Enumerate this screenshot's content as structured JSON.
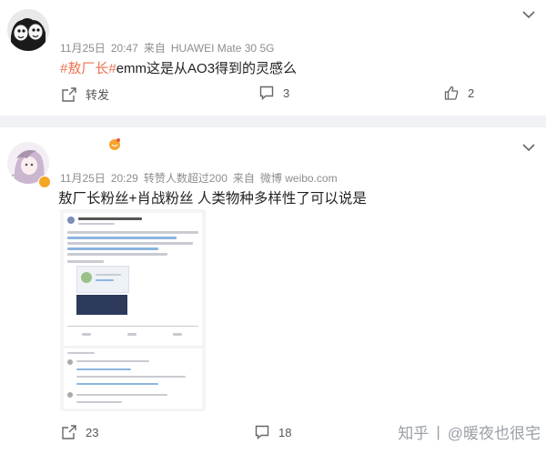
{
  "post1": {
    "date": "11月25日",
    "time": "20:47",
    "source_prefix": "来自",
    "source": "HUAWEI Mate 30 5G",
    "tag_text": "#敖厂长#",
    "text": "emm这是从AO3得到的灵感么",
    "repost_label": "转发",
    "comment_count": "3",
    "like_count": "2"
  },
  "post2": {
    "date": "11月25日",
    "time": "20:29",
    "extra": "转赞人数超过200",
    "source_prefix": "来自",
    "source": "微博 weibo.com",
    "text": "敖厂长粉丝+肖战粉丝 人类物种多样性了可以说是",
    "repost_count": "23",
    "comment_count": "18"
  },
  "watermark": {
    "brand": "知乎",
    "author": "@暖夜也很宅"
  },
  "colors": {
    "tag": "#eb7350",
    "meta": "#8d8d8d",
    "divider": "#f1f2f5"
  }
}
